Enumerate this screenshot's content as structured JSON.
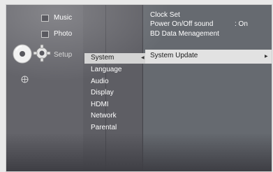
{
  "main_menu": {
    "items": [
      {
        "label": "Music",
        "icon": "music-icon"
      },
      {
        "label": "Photo",
        "icon": "photo-icon"
      },
      {
        "label": "Setup",
        "icon": "gear-icon"
      }
    ],
    "disc_icon": "disc-icon",
    "extra_icon": "globe-icon"
  },
  "setup_menu": {
    "items": [
      "System",
      "Language",
      "Audio",
      "Display",
      "HDMI",
      "Network",
      "Parental"
    ],
    "selected": "System"
  },
  "system_menu": {
    "clock_set": "Clock Set",
    "power_on_off_label": "Power On/Off sound",
    "power_on_off_value": ": On",
    "bd_data": "BD Data Menagement",
    "system_update": "System Update"
  },
  "colors": {
    "background": "#59595f",
    "highlight": "#e2e2e2",
    "text": "#ffffff"
  }
}
